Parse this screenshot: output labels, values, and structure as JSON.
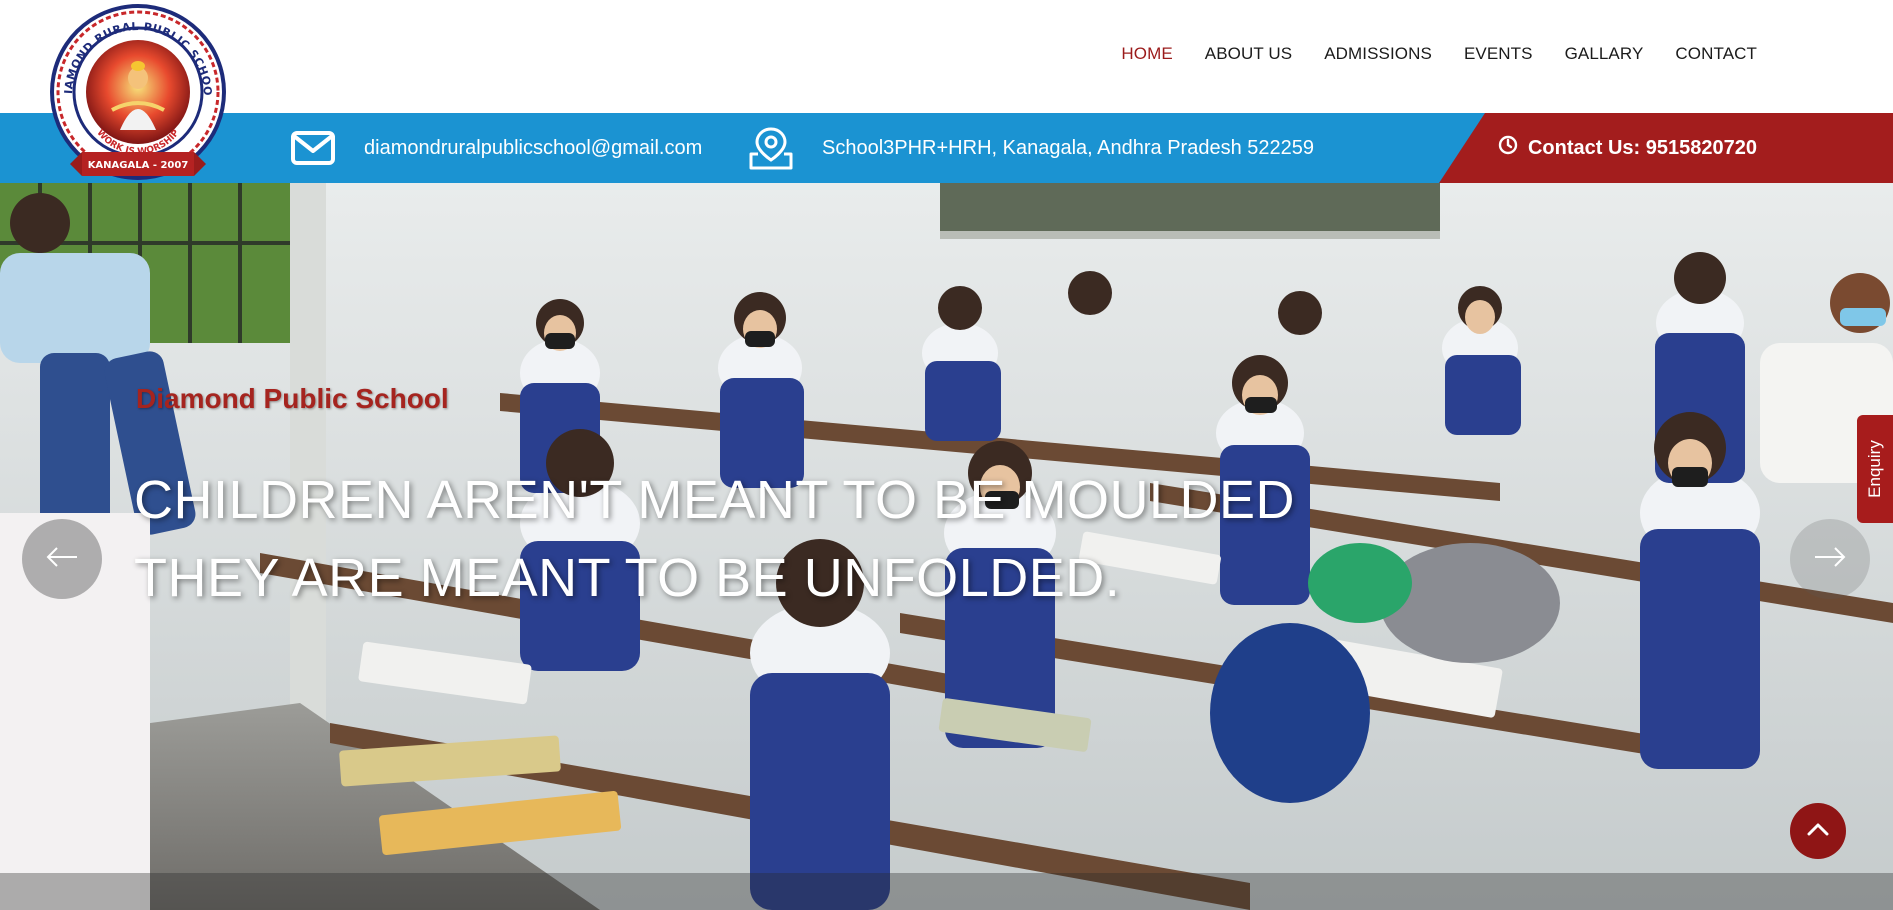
{
  "logo": {
    "arc_text": "DIAMOND RURAL PUBLIC SCHOOL",
    "motto": "WORK IS WORSHIP",
    "ribbon": "KANAGALA - 2007"
  },
  "nav": {
    "items": [
      {
        "label": "HOME",
        "active": true
      },
      {
        "label": "ABOUT US",
        "active": false
      },
      {
        "label": "ADMISSIONS",
        "active": false
      },
      {
        "label": "EVENTS",
        "active": false
      },
      {
        "label": "GALLARY",
        "active": false
      },
      {
        "label": "CONTACT",
        "active": false
      }
    ]
  },
  "infobar": {
    "email": "diamondruralpublicschool@gmail.com",
    "address": "School3PHR+HRH, Kanagala, Andhra Pradesh 522259",
    "contact": "Contact Us: 9515820720",
    "icons": [
      "envelope-icon",
      "map-pin-icon",
      "clock-icon"
    ]
  },
  "hero": {
    "subtitle": "Diamond Public School",
    "title_line1": "CHILDREN AREN'T MEANT TO BE MOULDED",
    "title_line2": "THEY ARE MEANT TO BE UNFOLDED."
  },
  "enquiry": {
    "label": "Enquiry"
  },
  "colors": {
    "nav_active": "#9b1b1b",
    "infobar_blue": "#1b93d2",
    "contact_red": "#a31d1d",
    "enquiry_red": "#a71c1c",
    "scroll_top": "#8f1515"
  }
}
